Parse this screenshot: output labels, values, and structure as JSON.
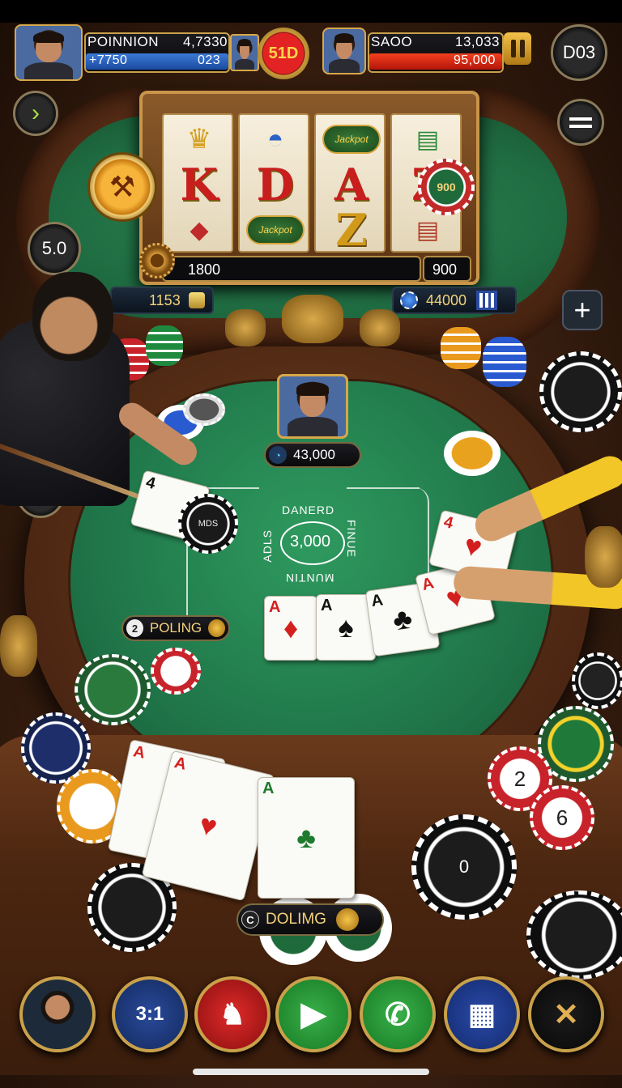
{
  "top_hud": {
    "left_player": {
      "name": "POINNION",
      "score": "4,7330",
      "bar_value": "+7750",
      "bar_value_right": "023"
    },
    "center_coin": "51D",
    "right_player": {
      "name": "SAOO",
      "score": "13,033",
      "bar_value": "95,000"
    },
    "right_round_label": "D03"
  },
  "side_controls": {
    "left_arrow_icon": "chevron-right-icon",
    "left_value": "5.0",
    "undo_icon": "undo-icon",
    "menu_icon": "menu-icon",
    "plus_icon": "plus-icon"
  },
  "slot_machine": {
    "reels": [
      [
        "crown",
        "K",
        "jewel"
      ],
      [
        "helmet",
        "D",
        "Jackpot"
      ],
      [
        "Jackpot",
        "A",
        "Z"
      ],
      [
        "scroll",
        "Z",
        "scroll"
      ]
    ],
    "chip_on_reel": "900",
    "bet_display": "1800",
    "bet_display_right": "900"
  },
  "pills": {
    "left_balance": "1153",
    "right_balance": "44000"
  },
  "main_table": {
    "dealer_pot": "43,000",
    "center_text_top": "DANERD",
    "center_text_right": "FINUE",
    "center_text_left": "ADLS",
    "center_text_bottom": "MUNTIN",
    "center_value": "3,000",
    "chip_label": "MDS",
    "poling_label": "POLING",
    "poling_prefix": "2"
  },
  "table_cards": [
    {
      "rank": "4",
      "suit": "♠",
      "color": "black"
    },
    {
      "rank": "A",
      "suit": "♦",
      "color": "red"
    },
    {
      "rank": "A",
      "suit": "♠",
      "color": "black"
    },
    {
      "rank": "A",
      "suit": "♣",
      "color": "black"
    },
    {
      "rank": "A",
      "suit": "♥",
      "color": "red"
    },
    {
      "rank": "4",
      "suit": "♥",
      "color": "red"
    }
  ],
  "player_hand": [
    {
      "rank": "A",
      "suit": "♦",
      "color": "red"
    },
    {
      "rank": "A",
      "suit": "♥",
      "color": "red"
    },
    {
      "rank": "A",
      "suit": "♣",
      "color": "green"
    }
  ],
  "foreground": {
    "doling_label": "DOLIMG",
    "doling_prefix": "C",
    "chip_numbers": [
      "2",
      "6",
      "0"
    ]
  },
  "bottom_bar": {
    "avatar_icon": "player-avatar-icon",
    "odds_label": "3:1",
    "alert_icon": "alert-bell-icon",
    "play_icon": "play-icon",
    "call_icon": "phone-icon",
    "cards_icon": "cards-icon",
    "settings_icon": "tools-icon"
  },
  "colors": {
    "felt": "#21784a",
    "wood": "#5a3018",
    "gold": "#c9a14a",
    "hp_blue": "#2a63c9",
    "hp_red": "#d62a1a"
  }
}
